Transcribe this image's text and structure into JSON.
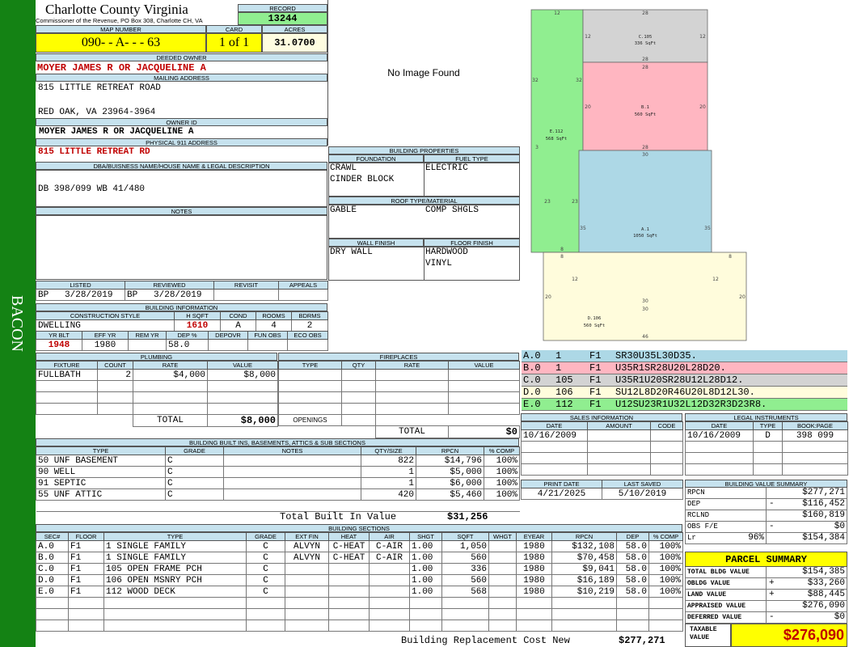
{
  "side_label": "BACON",
  "header": {
    "county": "Charlotte County Virginia",
    "office": "Commissioner of the Revenue, PO Box 308, Charlotte CH, VA",
    "record_label": "RECORD",
    "record": "13244",
    "map_label": "MAP NUMBER",
    "map_number": "090- - A- - - 63",
    "card_label": "CARD",
    "card": "1 of 1",
    "acres_label": "ACRES",
    "acres": "31.0700"
  },
  "owner": {
    "deeded_label": "DEEDED OWNER",
    "deeded": "MOYER JAMES R OR JACQUELINE A",
    "mailing_label": "MAILING ADDRESS",
    "mail_line1": "815 LITTLE RETREAT ROAD",
    "mail_line2": "",
    "mail_line3": "RED OAK, VA 23964-3964",
    "owner_id_label": "OWNER ID",
    "owner_id": "MOYER JAMES R OR JACQUELINE A",
    "physical_label": "PHYSICAL 911 ADDRESS",
    "physical": "815 LITTLE RETREAT RD",
    "dba_label": "DBA/BUISNESS NAME/HOUSE NAME & LEGAL DESCRIPTION",
    "legal": "DB 398/099 WB 41/480",
    "notes_label": "NOTES"
  },
  "no_image": "No Image Found",
  "building_properties": {
    "title": "BUILDING PROPERTIES",
    "foundation_label": "FOUNDATION",
    "foundation": [
      "CRAWL",
      "CINDER BLOCK"
    ],
    "fuel_label": "FUEL TYPE",
    "fuel": "ELECTRIC",
    "roof_label": "ROOF TYPE/MATERIAL",
    "roof_type": "GABLE",
    "roof_material": "COMP SHGLS",
    "wall_label": "WALL FINISH",
    "wall": "DRY WALL",
    "floor_label": "FLOOR FINISH",
    "floor": [
      "HARDWOOD",
      "VINYL"
    ]
  },
  "sketch": {
    "areas": [
      {
        "code": "C.105",
        "sqft": "336 SqFt",
        "color": "#d3d3d3"
      },
      {
        "code": "B.1",
        "sqft": "560 SqFt",
        "color": "#ffb6c1"
      },
      {
        "code": "E.112",
        "sqft": "568 SqFt",
        "color": "#90ee90"
      },
      {
        "code": "A.1",
        "sqft": "1050 SqFt",
        "color": "#add8e6"
      },
      {
        "code": "D.106",
        "sqft": "560 SqFt",
        "color": "#fffcdc"
      }
    ],
    "dims": [
      "12",
      "28",
      "12",
      "12",
      "32",
      "32",
      "28",
      "28",
      "20",
      "20",
      "3",
      "28",
      "30",
      "23",
      "23",
      "35",
      "35",
      "8",
      "8",
      "8",
      "12",
      "12",
      "20",
      "20",
      "30",
      "30",
      "46"
    ]
  },
  "vectors": [
    {
      "sec": "A.0",
      "num": "1",
      "fl": "F1",
      "vec": "SR30U35L30D35.",
      "color": "#add8e6"
    },
    {
      "sec": "B.0",
      "num": "1",
      "fl": "F1",
      "vec": "U35R1SR28U20L28D20.",
      "color": "#ffb6c1"
    },
    {
      "sec": "C.0",
      "num": "105",
      "fl": "F1",
      "vec": "U35R1U20SR28U12L28D12.",
      "color": "#d3d3d3"
    },
    {
      "sec": "D.0",
      "num": "106",
      "fl": "F1",
      "vec": "SU12L8D20R46U20L8D12L30.",
      "color": "#fffcdc"
    },
    {
      "sec": "E.0",
      "num": "112",
      "fl": "F1",
      "vec": "U12SU23R1U32L12D32R3D23R8.",
      "color": "#90ee90"
    }
  ],
  "listing": {
    "listed_label": "LISTED",
    "reviewed_label": "REVIEWED",
    "revisit_label": "REVISIT",
    "appeals_label": "APPEALS",
    "listed_code": "BP",
    "listed_date": "3/28/2019",
    "reviewed_code": "BP",
    "reviewed_date": "3/28/2019"
  },
  "building_info": {
    "title": "BUILDING INFORMATION",
    "construction_label": "CONSTRUCTION STYLE",
    "hsqft_label": "H SQFT",
    "cond_label": "COND",
    "rooms_label": "ROOMS",
    "bdrms_label": "BDRMS",
    "construction": "DWELLING",
    "hsqft": "1610",
    "cond": "A",
    "rooms": "4",
    "bdrms": "2",
    "yrblt_label": "YR BLT",
    "effyr_label": "EFF YR",
    "remyr_label": "REM YR",
    "dep_label": "DEP %",
    "depovr_label": "DEPOVR",
    "funobs_label": "FUN OBS",
    "ecoobs_label": "ECO OBS",
    "yrblt": "1948",
    "effyr": "1980",
    "remyr": "",
    "dep": "58.0",
    "depovr": "",
    "funobs": "",
    "ecoobs": ""
  },
  "plumbing": {
    "title": "PLUMBING",
    "headers": [
      "FIXTURE",
      "COUNT",
      "RATE",
      "VALUE"
    ],
    "rows": [
      [
        "FULLBATH",
        "2",
        "$4,000",
        "$8,000"
      ]
    ],
    "total_label": "TOTAL",
    "total": "$8,000"
  },
  "fireplaces": {
    "title": "FIREPLACES",
    "headers": [
      "TYPE",
      "QTY",
      "RATE",
      "VALUE"
    ],
    "openings_label": "OPENINGS",
    "total_label": "TOTAL",
    "total": "$0"
  },
  "built_ins": {
    "title": "BUILDING BUILT INS, BASEMENTS, ATTICS & SUB SECTIONS",
    "headers": [
      "TYPE",
      "GRADE",
      "NOTES",
      "QTY/SIZE",
      "RPCN",
      "% COMP"
    ],
    "rows": [
      [
        "50 UNF BASEMENT",
        "C",
        "",
        "822",
        "$14,796",
        "100%"
      ],
      [
        "90 WELL",
        "C",
        "",
        "1",
        "$5,000",
        "100%"
      ],
      [
        "91 SEPTIC",
        "C",
        "",
        "1",
        "$6,000",
        "100%"
      ],
      [
        "55 UNF ATTIC",
        "C",
        "",
        "420",
        "$5,460",
        "100%"
      ]
    ],
    "total_label": "Total Built In Value",
    "total": "$31,256"
  },
  "sales": {
    "title": "SALES INFORMATION",
    "headers": [
      "DATE",
      "AMOUNT",
      "CODE"
    ],
    "rows": [
      [
        "10/16/2009",
        "",
        ""
      ]
    ]
  },
  "legal_instruments": {
    "title": "LEGAL INSTRUMENTS",
    "headers": [
      "DATE",
      "TYPE",
      "BOOK:PAGE"
    ],
    "rows": [
      [
        "10/16/2009",
        "D",
        "398 099"
      ]
    ]
  },
  "print_info": {
    "print_label": "PRINT DATE",
    "print_date": "4/21/2025",
    "saved_label": "LAST SAVED",
    "saved_date": "5/10/2019"
  },
  "value_summary": {
    "title": "BUILDING VALUE SUMMARY",
    "rows": [
      {
        "label": "RPCN",
        "sign": "",
        "pct": "",
        "value": "$277,271"
      },
      {
        "label": "DEP",
        "sign": "-",
        "pct": "",
        "value": "$116,452"
      },
      {
        "label": "RCLND",
        "sign": "",
        "pct": "",
        "value": "$160,819"
      },
      {
        "label": "OBS F/E",
        "sign": "-",
        "pct": "",
        "value": "$0"
      },
      {
        "label": "Lr",
        "sign": "",
        "pct": "96%",
        "value": "$154,384"
      }
    ]
  },
  "parcel_summary": {
    "title": "PARCEL SUMMARY",
    "rows": [
      {
        "label": "TOTAL BLDG VALUE",
        "sign": "",
        "value": "$154,385"
      },
      {
        "label": "OBLDG VALUE",
        "sign": "+",
        "value": "$33,260"
      },
      {
        "label": "LAND VALUE",
        "sign": "+",
        "value": "$88,445"
      },
      {
        "label": "APPRAISED VALUE",
        "sign": "",
        "value": "$276,090"
      },
      {
        "label": "DEFERRED VALUE",
        "sign": "-",
        "value": "$0"
      }
    ],
    "taxable_label_1": "TAXABLE",
    "taxable_label_2": "VALUE",
    "taxable": "$276,090"
  },
  "sections": {
    "title": "BUILDING SECTIONS",
    "headers": [
      "SEC#",
      "FLOOR",
      "TYPE",
      "GRADE",
      "EXT FIN",
      "HEAT",
      "AIR",
      "SHGT",
      "SQFT",
      "WHGT",
      "EYEAR",
      "RPCN",
      "DEP",
      "% COMP"
    ],
    "rows": [
      [
        "A.0",
        "F1",
        "1 SINGLE FAMILY",
        "C",
        "ALVYN",
        "C-HEAT",
        "C-AIR",
        "1.00",
        "1,050",
        "",
        "1980",
        "$132,108",
        "58.0",
        "100%"
      ],
      [
        "B.0",
        "F1",
        "1 SINGLE FAMILY",
        "C",
        "ALVYN",
        "C-HEAT",
        "C-AIR",
        "1.00",
        "560",
        "",
        "1980",
        "$70,458",
        "58.0",
        "100%"
      ],
      [
        "C.0",
        "F1",
        "105 OPEN FRAME PCH",
        "C",
        "",
        "",
        "",
        "1.00",
        "336",
        "",
        "1980",
        "$9,041",
        "58.0",
        "100%"
      ],
      [
        "D.0",
        "F1",
        "106 OPEN MSNRY PCH",
        "C",
        "",
        "",
        "",
        "1.00",
        "560",
        "",
        "1980",
        "$16,189",
        "58.0",
        "100%"
      ],
      [
        "E.0",
        "F1",
        "112 WOOD DECK",
        "C",
        "",
        "",
        "",
        "1.00",
        "568",
        "",
        "1980",
        "$10,219",
        "58.0",
        "100%"
      ]
    ],
    "total_label": "Building Replacement Cost New",
    "total": "$277,271"
  }
}
